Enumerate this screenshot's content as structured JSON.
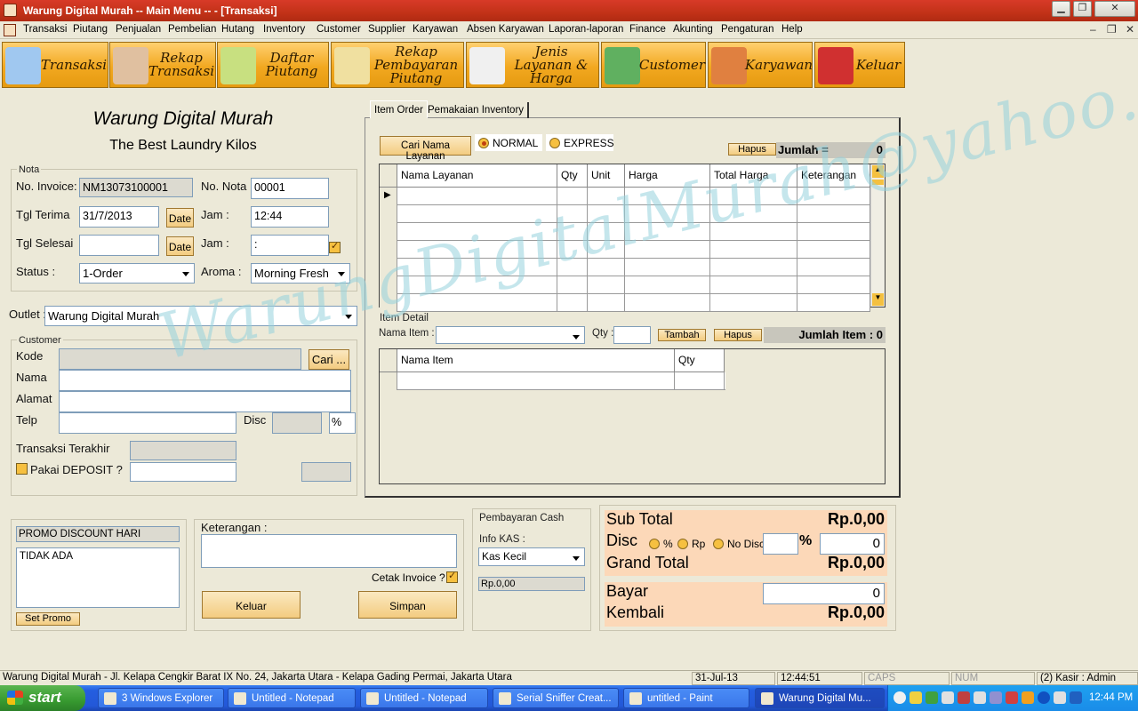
{
  "window": {
    "title": "Warung Digital Murah  -- Main Menu -- - [Transaksi]"
  },
  "menu": [
    "Transaksi",
    "Piutang",
    "Penjualan",
    "Pembelian",
    "Hutang",
    "Inventory",
    "Customer",
    "Supplier",
    "Karyawan",
    "Absen Karyawan",
    "Laporan-laporan",
    "Finance",
    "Akunting",
    "Pengaturan",
    "Help"
  ],
  "toolbar": [
    {
      "label": "Transaksi",
      "icon": "basket-icon"
    },
    {
      "label": "Rekap\nTransaksi",
      "icon": "shop-icon"
    },
    {
      "label": "Daftar\nPiutang",
      "icon": "calculator-icon"
    },
    {
      "label": "Rekap\nPembayaran\nPiutang",
      "icon": "card-payment-icon"
    },
    {
      "label": "Jenis\nLayanan &\nHarga",
      "icon": "shirt-icon"
    },
    {
      "label": "Customer",
      "icon": "customers-icon"
    },
    {
      "label": "Karyawan",
      "icon": "employee-icon"
    },
    {
      "label": "Keluar",
      "icon": "exit-icon"
    }
  ],
  "header": {
    "company": "Warung Digital Murah",
    "tagline": "The Best Laundry Kilos"
  },
  "nota": {
    "group": "Nota",
    "no_invoice_label": "No. Invoice:",
    "no_invoice": "NM13073100001",
    "no_nota_label": "No. Nota",
    "no_nota": "00001",
    "tgl_terima_label": "Tgl Terima",
    "tgl_terima": "31/7/2013",
    "jam_label": "Jam :",
    "jam": "12:44",
    "tgl_selesai_label": "Tgl Selesai",
    "tgl_selesai": "",
    "jam2_label": "Jam :",
    "jam2": ":",
    "date_btn": "Date",
    "status_label": "Status :",
    "status": "1-Order",
    "aroma_label": "Aroma :",
    "aroma": "Morning Fresh"
  },
  "outlet": {
    "label": "Outlet :",
    "value": "Warung Digital Murah"
  },
  "customer": {
    "group": "Customer",
    "kode_label": "Kode",
    "cari_btn": "Cari ...",
    "nama_label": "Nama",
    "alamat_label": "Alamat",
    "telp_label": "Telp",
    "disc_label": "Disc",
    "disc_pct": "%",
    "transaksi_label": "Transaksi Terakhir",
    "deposit_label": "Pakai DEPOSIT ?"
  },
  "promo": {
    "title": "PROMO DISCOUNT HARI",
    "value": "TIDAK ADA",
    "btn": "Set Promo"
  },
  "keterangan": {
    "label": "Keterangan :",
    "cetak_label": "Cetak Invoice ?",
    "keluar": "Keluar",
    "simpan": "Simpan"
  },
  "pembayaran": {
    "group": "Pembayaran Cash",
    "info_kas_label": "Info KAS :",
    "kas": "Kas Kecil",
    "saldo": "Rp.0,00"
  },
  "tabs": [
    "Item Order",
    "Pemakaian Inventory"
  ],
  "order": {
    "cari_btn": "Cari Nama Layanan",
    "radio_normal": "NORMAL",
    "radio_express": "EXPRESS",
    "hapus_btn": "Hapus",
    "jumlah_label": "Jumlah =",
    "jumlah": "0",
    "columns": [
      "Nama Layanan",
      "Qty",
      "Unit",
      "Harga",
      "Total Harga",
      "Keterangan"
    ]
  },
  "detail": {
    "group": "Item Detail",
    "nama_item_label": "Nama Item :",
    "qty_label": "Qty :",
    "tambah_btn": "Tambah",
    "hapus_btn": "Hapus",
    "jumlah_label": "Jumlah Item : 0",
    "columns": [
      "Nama Item",
      "Qty"
    ]
  },
  "summary": {
    "subtotal_label": "Sub Total",
    "subtotal": "Rp.0,00",
    "disc_label": "Disc",
    "opt_pct": "%",
    "opt_rp": "Rp",
    "opt_nodisc": "No Disc",
    "pct_sign": "%",
    "disc_value": "0",
    "grand_label": "Grand Total",
    "grand": "Rp.0,00",
    "bayar_label": "Bayar",
    "bayar": "0",
    "kembali_label": "Kembali",
    "kembali": "Rp.0,00"
  },
  "watermark": "WarungDigitalMurah@yahoo.com",
  "statusbar": {
    "address": "Warung Digital Murah - Jl. Kelapa Cengkir Barat IX No. 24, Jakarta Utara - Kelapa Gading Permai, Jakarta Utara",
    "date": "31-Jul-13",
    "time": "12:44:51",
    "caps": "CAPS",
    "num": "NUM",
    "kasir": "(2) Kasir : Admin"
  },
  "taskbar": {
    "start": "start",
    "items": [
      "3 Windows Explorer",
      "Untitled - Notepad",
      "Untitled - Notepad",
      "Serial Sniffer Creat...",
      "untitled - Paint",
      "Warung Digital Mu..."
    ],
    "clock": "12:44 PM"
  }
}
